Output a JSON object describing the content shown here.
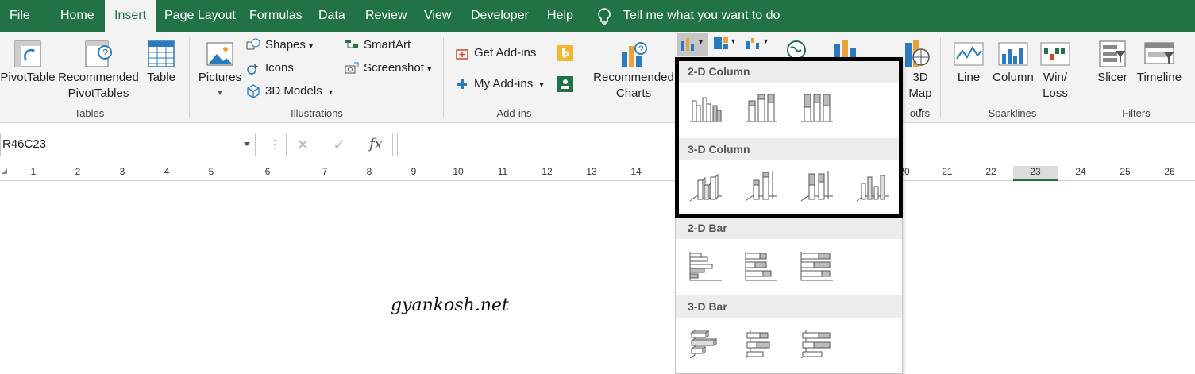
{
  "tabs": [
    "File",
    "Home",
    "Insert",
    "Page Layout",
    "Formulas",
    "Data",
    "Review",
    "View",
    "Developer",
    "Help"
  ],
  "active_tab": "Insert",
  "tell_me": "Tell me what you want to do",
  "ribbon": {
    "pivottable": "PivotTable",
    "recommended_pivot_line1": "Recommended",
    "recommended_pivot_line2": "PivotTables",
    "table": "Table",
    "tables_group": "Tables",
    "pictures": "Pictures",
    "shapes": "Shapes",
    "icons": "Icons",
    "models3d": "3D Models",
    "smartart": "SmartArt",
    "screenshot": "Screenshot",
    "illustrations_group": "Illustrations",
    "get_addins": "Get Add-ins",
    "my_addins": "My Add-ins",
    "addins_group": "Add-ins",
    "recommended_charts_line1": "Recommended",
    "recommended_charts_line2": "Charts",
    "map3d_line1": "3D",
    "map3d_line2": "Map",
    "tours_group": "ours",
    "line": "Line",
    "column": "Column",
    "winloss_line1": "Win/",
    "winloss_line2": "Loss",
    "sparklines_group": "Sparklines",
    "slicer": "Slicer",
    "timeline": "Timeline",
    "filters_group": "Filters"
  },
  "namebox": "R46C23",
  "fx_symbol": "fx",
  "ruler": [
    "1",
    "2",
    "3",
    "4",
    "5",
    "6",
    "7",
    "8",
    "9",
    "10",
    "11",
    "12",
    "13",
    "14",
    "20",
    "21",
    "22",
    "23",
    "24",
    "25",
    "26"
  ],
  "ruler_selected": "23",
  "dropdown": {
    "col2d": "2-D Column",
    "col3d": "3-D Column",
    "bar2d": "2-D Bar",
    "bar3d": "3-D Bar"
  },
  "watermark": "gyankosh.net",
  "colors": {
    "brand": "#217346",
    "ribbon_bg": "#f3f3f3",
    "highlight": "#000000"
  }
}
